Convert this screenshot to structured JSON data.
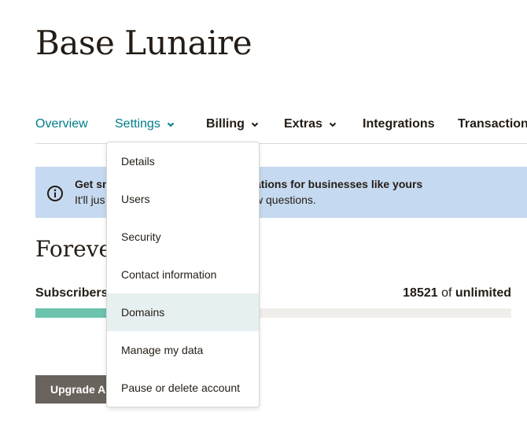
{
  "header": {
    "title": "Base Lunaire"
  },
  "nav": {
    "tabs": [
      {
        "label": "Overview",
        "has_dropdown": false
      },
      {
        "label": "Settings",
        "has_dropdown": true
      },
      {
        "label": "Billing",
        "has_dropdown": true
      },
      {
        "label": "Extras",
        "has_dropdown": true
      },
      {
        "label": "Integrations",
        "has_dropdown": false
      },
      {
        "label": "Transaction",
        "has_dropdown": false
      }
    ]
  },
  "banner": {
    "icon": "info-icon",
    "line1_start": "Get sn",
    "line1_end": "ations for businesses like yours",
    "line2_start": "It'll jus",
    "line2_end": "w questions."
  },
  "plan": {
    "title": "Foreve",
    "subscribers_label": "Subscribers",
    "subscribers_count": "18521",
    "subscribers_of": "of",
    "subscribers_limit": "unlimited",
    "progress_fraction": 0.15
  },
  "upgrade_button": {
    "label": "Upgrade A"
  },
  "settings_menu": {
    "items": [
      {
        "label": "Details"
      },
      {
        "label": "Users"
      },
      {
        "label": "Security"
      },
      {
        "label": "Contact information"
      },
      {
        "label": "Domains",
        "active": true
      },
      {
        "label": "Manage my data"
      },
      {
        "label": "Pause or delete account"
      }
    ]
  },
  "colors": {
    "teal_link": "#007c89",
    "banner_bg": "#c5daf0",
    "progress_fill": "#6bc3ad",
    "button_bg": "#69635d",
    "menu_hover": "#e6f0f0"
  }
}
